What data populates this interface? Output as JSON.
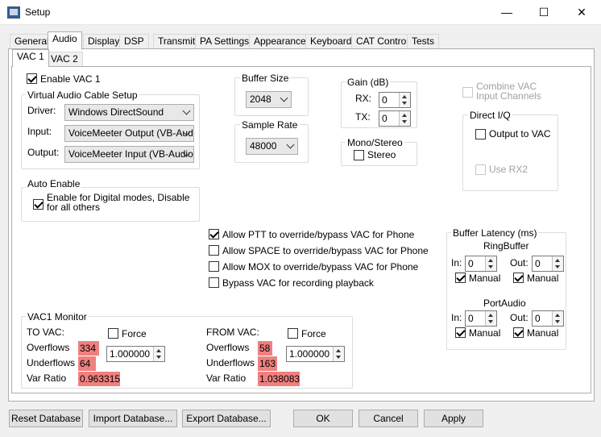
{
  "window": {
    "title": "Setup",
    "min": "—",
    "max": "☐",
    "close": "✕"
  },
  "tabs": [
    "General",
    "Audio",
    "Display",
    "DSP",
    "Transmit",
    "PA Settings",
    "Appearance",
    "Keyboard",
    "CAT Control",
    "Tests"
  ],
  "subtabs": [
    "VAC 1",
    "VAC 2"
  ],
  "enable_vac1": "Enable VAC 1",
  "vac_setup": {
    "title": "Virtual Audio Cable Setup",
    "driver_label": "Driver:",
    "driver_value": "Windows DirectSound",
    "input_label": "Input:",
    "input_value": "VoiceMeeter Output (VB-Aud",
    "output_label": "Output:",
    "output_value": "VoiceMeeter Input (VB-Audio"
  },
  "buffer_size": {
    "title": "Buffer Size",
    "value": "2048"
  },
  "sample_rate": {
    "title": "Sample Rate",
    "value": "48000"
  },
  "gain": {
    "title": "Gain (dB)",
    "rx_label": "RX:",
    "rx_value": "0",
    "tx_label": "TX:",
    "tx_value": "0"
  },
  "mono_stereo": {
    "title": "Mono/Stereo",
    "stereo_label": "Stereo"
  },
  "combine_vac": {
    "line1": "Combine VAC",
    "line2": "Input Channels"
  },
  "direct_iq": {
    "title": "Direct I/Q",
    "output_label": "Output to VAC",
    "rx2_label": "Use RX2"
  },
  "auto_enable": {
    "title": "Auto Enable",
    "line1": "Enable for Digital modes, Disable",
    "line2": "for all others"
  },
  "options": [
    "Allow PTT to override/bypass VAC for Phone",
    "Allow SPACE to override/bypass VAC for Phone",
    "Allow MOX to override/bypass VAC for Phone",
    "Bypass VAC for recording playback"
  ],
  "buffer_latency": {
    "title": "Buffer Latency (ms)",
    "ring_title": "RingBuffer",
    "port_title": "PortAudio",
    "in_label": "In:",
    "out_label": "Out:",
    "ring_in": "0",
    "ring_out": "0",
    "port_in": "0",
    "port_out": "0",
    "manual_label": "Manual"
  },
  "monitor": {
    "title": "VAC1 Monitor",
    "to_vac": "TO VAC:",
    "from_vac": "FROM VAC:",
    "force_label": "Force",
    "overflows_label": "Overflows",
    "underflows_label": "Underflows",
    "var_ratio_label": "Var Ratio",
    "to_overflows": "334",
    "to_underflows": "64",
    "to_var_ratio": "0.963315",
    "to_force_value": "1.000000",
    "from_overflows": "58",
    "from_underflows": "163",
    "from_var_ratio": "1.038083",
    "from_force_value": "1.000000"
  },
  "buttons": {
    "reset_db": "Reset Database",
    "import_db": "Import Database...",
    "export_db": "Export Database...",
    "ok": "OK",
    "cancel": "Cancel",
    "apply": "Apply"
  }
}
